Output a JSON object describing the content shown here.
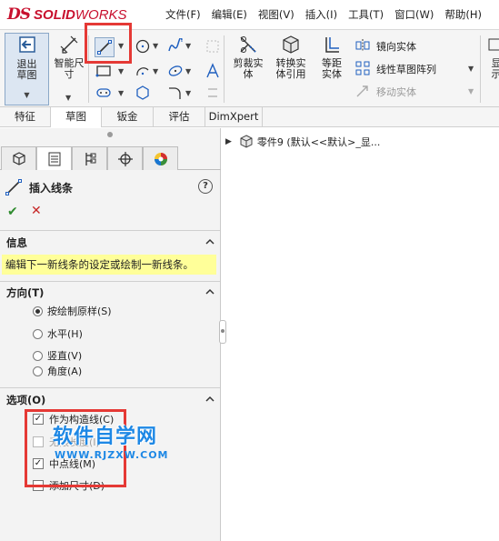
{
  "app": {
    "logo_ds": "DS",
    "logo_solid": "SOLID",
    "logo_works": "WORKS"
  },
  "menu": {
    "items": [
      "文件(F)",
      "编辑(E)",
      "视图(V)",
      "插入(I)",
      "工具(T)",
      "窗口(W)",
      "帮助(H)"
    ]
  },
  "toolbar": {
    "exit_sketch": "退出草图",
    "smart_dimension": "智能尺寸",
    "trim": "剪裁实体",
    "convert": "转换实体引用",
    "offset": "等距实体",
    "mirror": "镜向实体",
    "linear_pattern": "线性草图阵列",
    "move": "移动实体",
    "display_truncated": "显示"
  },
  "tabs": [
    "特征",
    "草图",
    "钣金",
    "评估",
    "DimXpert"
  ],
  "active_tab": "草图",
  "property_manager": {
    "title": "插入线条",
    "help": "?",
    "info_group": {
      "title": "信息",
      "message": "编辑下一新线条的设定或绘制一新线条。"
    },
    "orientation_group": {
      "title": "方向(T)",
      "options": [
        {
          "label": "按绘制原样(S)",
          "selected": true
        },
        {
          "label": "水平(H)",
          "selected": false
        },
        {
          "label": "竖直(V)",
          "selected": false
        },
        {
          "label": "角度(A)",
          "selected": false
        }
      ]
    },
    "options_group": {
      "title": "选项(O)",
      "checkboxes": [
        {
          "label": "作为构造线(C)",
          "checked": true,
          "enabled": true
        },
        {
          "label": "无限长度(I)",
          "checked": false,
          "enabled": false
        },
        {
          "label": "中点线(M)",
          "checked": true,
          "enabled": true
        },
        {
          "label": "添加尺寸(D)",
          "checked": false,
          "enabled": true
        }
      ]
    }
  },
  "tree": {
    "item": "零件9  (默认<<默认>_显..."
  },
  "watermark": {
    "title": "软件自学网",
    "url": "WWW.RJZXW.COM"
  },
  "colors": {
    "highlight_red": "#e53935",
    "info_yellow": "#ffff99",
    "brand_red": "#c8102e",
    "ok_green": "#2e8b2e",
    "watermark_blue": "#1e88e5"
  }
}
